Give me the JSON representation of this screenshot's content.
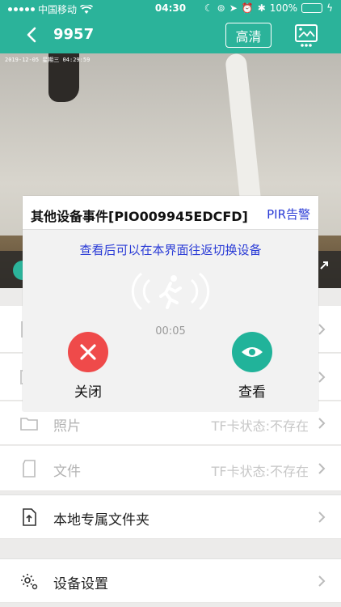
{
  "status_bar": {
    "carrier": "中国移动",
    "time": "04:30",
    "battery_percent": "100%"
  },
  "nav": {
    "title": "9957",
    "hd_label": "高清"
  },
  "video": {
    "timestamp": "2019-12-05 星期三 04:29:59"
  },
  "modal": {
    "title": "其他设备事件[PIO009945EDCFD]",
    "tag": "PIR告警",
    "subtitle": "查看后可以在本界面往返切换设备",
    "timer": "00:05",
    "close_label": "关闭",
    "view_label": "查看"
  },
  "list": {
    "photos_label": "照片",
    "photos_hint": "TF卡状态:不存在",
    "files_label": "文件",
    "files_hint": "TF卡状态:不存在",
    "local_folder_label": "本地专属文件夹",
    "device_settings_label": "设备设置"
  },
  "colors": {
    "brand": "#2bb39a",
    "danger": "#ef4a4a",
    "link_blue": "#2a3bd6"
  }
}
